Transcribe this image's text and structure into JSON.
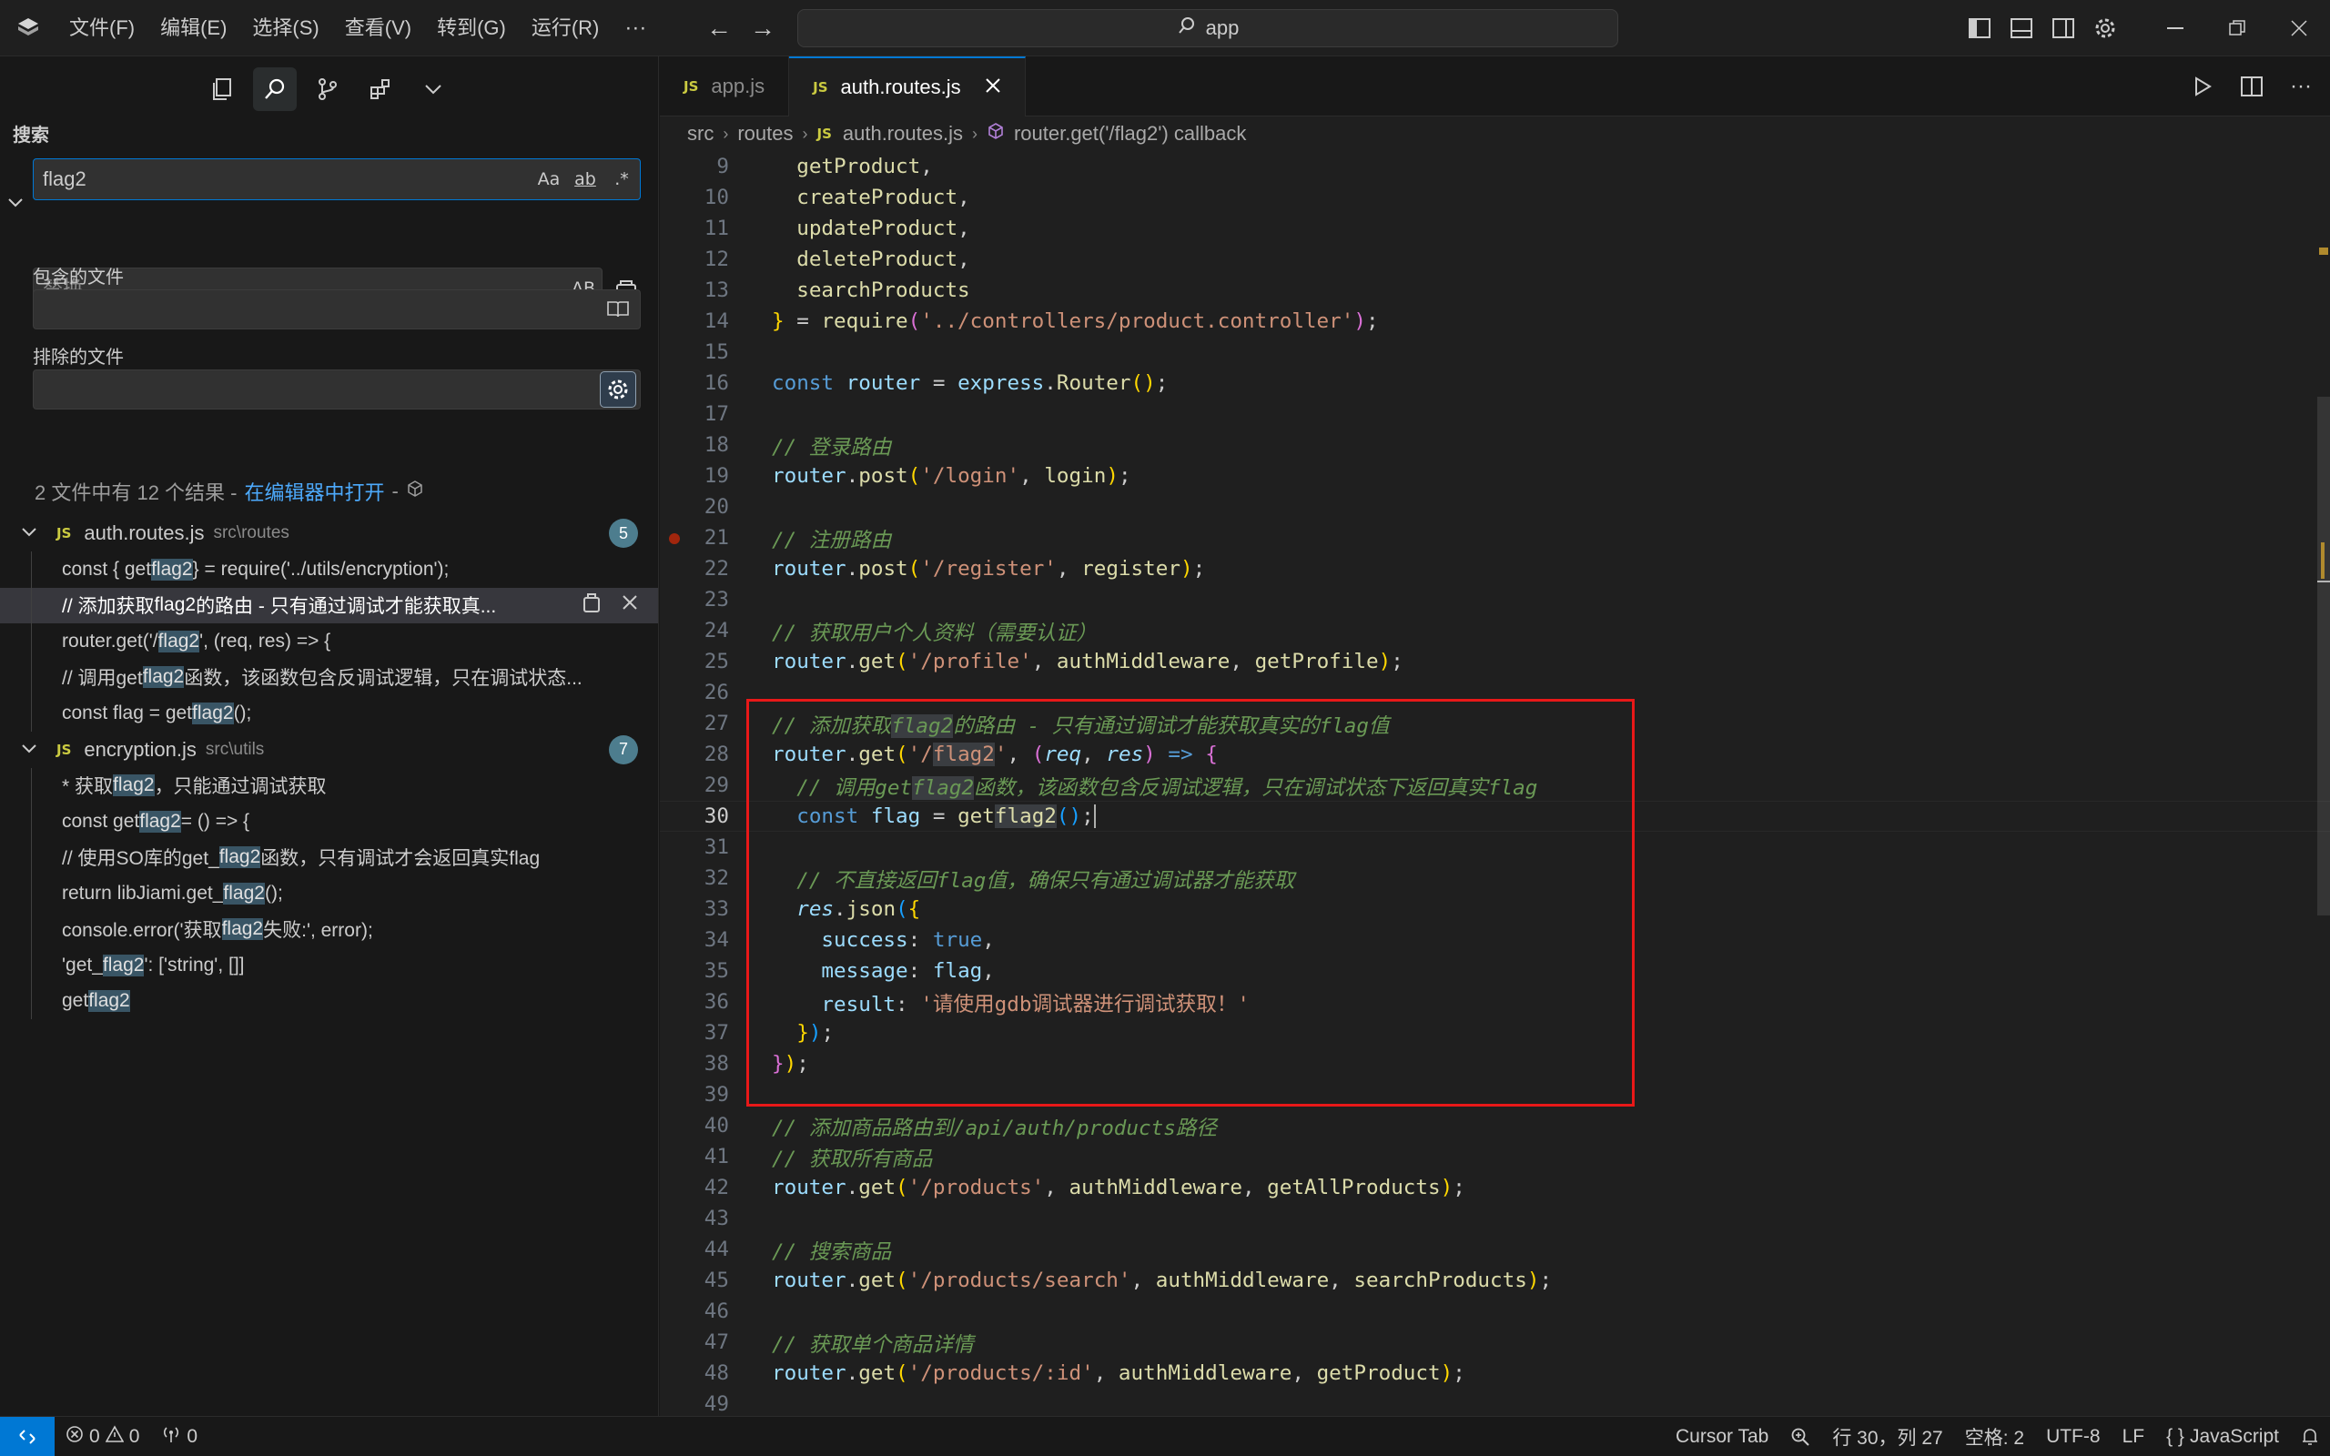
{
  "titlebar": {
    "menu": [
      "文件(F)",
      "编辑(E)",
      "选择(S)",
      "查看(V)",
      "转到(G)",
      "运行(R)"
    ],
    "more": "···",
    "back": "←",
    "forward": "→",
    "command_center": "app"
  },
  "sidebar": {
    "title": "搜索",
    "search_value": "flag2",
    "search_options": [
      "Aa",
      "ab",
      ".*"
    ],
    "replace_placeholder": "替换",
    "replace_option": "AB",
    "more_options": "···",
    "include_label": "包含的文件",
    "exclude_label": "排除的文件",
    "summary_prefix": "2 文件中有 12 个结果 - ",
    "summary_link": "在编辑器中打开",
    "summary_suffix": " -",
    "results": [
      {
        "file": "auth.routes.js",
        "path": "src\\routes",
        "count": "5",
        "matches": [
          {
            "pre": "const { get",
            "hit": "flag2",
            "post": " } = require('../utils/encryption');"
          },
          {
            "pre": "// 添加获取",
            "hit": "flag2",
            "post": "的路由 - 只有通过调试才能获取真..."
          },
          {
            "pre": "router.get('/",
            "hit": "flag2",
            "post": "', (req, res) => {"
          },
          {
            "pre": "// 调用get",
            "hit": "flag2",
            "post": "函数，该函数包含反调试逻辑，只在调试状态..."
          },
          {
            "pre": "const flag = get",
            "hit": "flag2",
            "post": "();"
          }
        ]
      },
      {
        "file": "encryption.js",
        "path": "src\\utils",
        "count": "7",
        "matches": [
          {
            "pre": "* 获取",
            "hit": "flag2",
            "post": "，只能通过调试获取"
          },
          {
            "pre": "const get",
            "hit": "flag2",
            "post": " = () => {"
          },
          {
            "pre": "// 使用SO库的get_",
            "hit": "flag2",
            "post": "函数，只有调试才会返回真实flag"
          },
          {
            "pre": "return libJiami.get_",
            "hit": "flag2",
            "post": "();"
          },
          {
            "pre": "console.error('获取",
            "hit": "flag2",
            "post": "失败:', error);"
          },
          {
            "pre": "'get_",
            "hit": "flag2",
            "post": "': ['string', []]"
          },
          {
            "pre": "get",
            "hit": "flag2",
            "post": ""
          }
        ]
      }
    ]
  },
  "editor": {
    "tabs": [
      {
        "label": "app.js",
        "active": false
      },
      {
        "label": "auth.routes.js",
        "active": true
      }
    ],
    "breadcrumb": [
      "src",
      "routes",
      "auth.routes.js",
      "router.get('/flag2') callback"
    ],
    "line_numbers": [
      "9",
      "10",
      "11",
      "12",
      "13",
      "14",
      "15",
      "16",
      "17",
      "18",
      "19",
      "20",
      "21",
      "22",
      "23",
      "24",
      "25",
      "26",
      "27",
      "28",
      "29",
      "30",
      "31",
      "32",
      "33",
      "34",
      "35",
      "36",
      "37",
      "38",
      "39",
      "40",
      "41",
      "42",
      "43",
      "44",
      "45",
      "46",
      "47",
      "48",
      "49"
    ],
    "current_line": "30"
  },
  "statusbar": {
    "errors": "0",
    "warnings": "0",
    "ports": "0",
    "cursor_tab": "Cursor Tab",
    "position": "行 30，列 27",
    "spaces": "空格: 2",
    "encoding": "UTF-8",
    "eol": "LF",
    "language": "JavaScript"
  },
  "colors": {
    "accent": "#0078d4",
    "highlight_box": "#e81818",
    "match_highlight": "#395565"
  },
  "icons": [
    "app-logo-icon",
    "explorer-icon",
    "search-icon",
    "source-control-icon",
    "extensions-icon",
    "chevron-down-icon",
    "layout-sidebar-icon",
    "layout-panel-icon",
    "layout-secondary-icon",
    "gear-icon",
    "minimize-icon",
    "restore-icon",
    "close-icon",
    "run-icon",
    "split-editor-icon",
    "more-icon",
    "bell-icon",
    "zoom-icon"
  ]
}
